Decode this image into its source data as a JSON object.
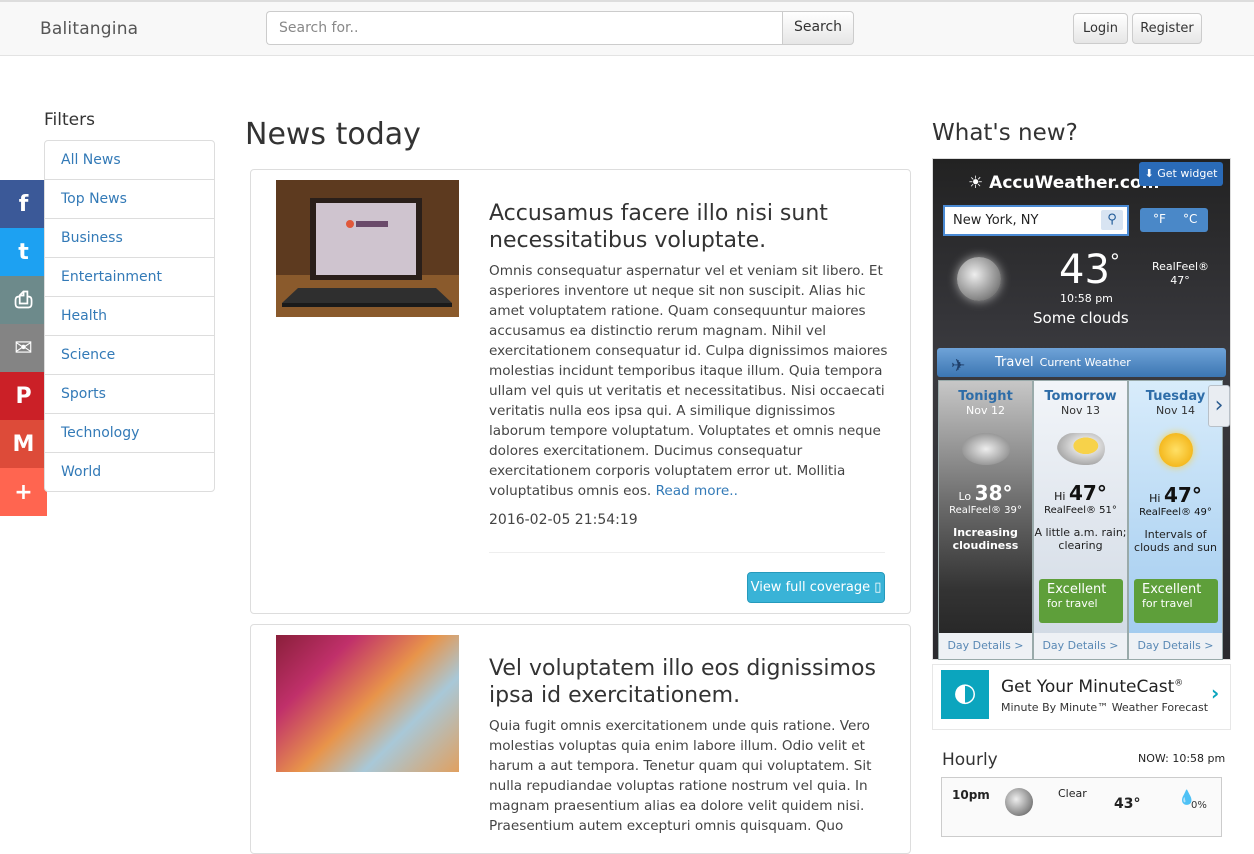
{
  "navbar": {
    "brand": "Balitangina",
    "search_placeholder": "Search for..",
    "search_label": "Search",
    "login_label": "Login",
    "register_label": "Register"
  },
  "social": [
    {
      "name": "facebook",
      "glyph": "f",
      "color": "#3b5998"
    },
    {
      "name": "twitter",
      "glyph": "t",
      "color": "#1da1f2"
    },
    {
      "name": "print",
      "glyph": "⎙",
      "color": "#6d8a8b"
    },
    {
      "name": "email",
      "glyph": "✉",
      "color": "#848484"
    },
    {
      "name": "pinterest",
      "glyph": "P",
      "color": "#cb2027"
    },
    {
      "name": "gmail",
      "glyph": "M",
      "color": "#dd4b39"
    },
    {
      "name": "more",
      "glyph": "+",
      "color": "#ff6550"
    }
  ],
  "filters": {
    "title": "Filters",
    "items": [
      "All News",
      "Top News",
      "Business",
      "Entertainment",
      "Health",
      "Science",
      "Sports",
      "Technology",
      "World"
    ]
  },
  "news": {
    "heading": "News today",
    "articles": [
      {
        "title": "Accusamus facere illo nisi sunt necessitatibus voluptate.",
        "body": "Omnis consequatur aspernatur vel et veniam sit libero. Et asperiores inventore ut neque sit non suscipit. Alias hic amet voluptatem ratione. Quam consequuntur maiores accusamus ea distinctio rerum magnam. Nihil vel exercitationem consequatur id. Culpa dignissimos maiores molestias incidunt temporibus itaque illum. Quia tempora ullam vel quis ut veritatis et necessitatibus. Nisi occaecati veritatis nulla eos ipsa qui. A similique dignissimos laborum tempore voluptatum. Voluptates et omnis neque dolores exercitationem. Ducimus consequatur exercitationem corporis voluptatem error ut. Mollitia voluptatibus omnis eos.",
        "read_more": "Read more..",
        "date": "2016-02-05 21:54:19",
        "coverage_label": "View full coverage ▯"
      },
      {
        "title": "Vel voluptatem illo eos dignissimos ipsa id exercitationem.",
        "body": "Quia fugit omnis exercitationem unde quis ratione. Vero molestias voluptas quia enim labore illum. Odio velit et harum a aut tempora. Tenetur quam qui voluptatem. Sit nulla repudiandae voluptas ratione nostrum vel quia. In magnam praesentium alias ea dolore velit quidem nisi. Praesentium autem excepturi omnis quisquam. Quo"
      }
    ]
  },
  "sidebar": {
    "title": "What's new?"
  },
  "accuweather": {
    "logo": "AccuWeather.com",
    "get_widget": "Get widget",
    "location": "New York, NY",
    "unit_f": "°F",
    "unit_c": "°C",
    "temp": "43",
    "degree": "°",
    "time": "10:58 pm",
    "condition": "Some clouds",
    "realfeel_label": "RealFeel®",
    "realfeel_value": "47°",
    "travel_label": "Travel",
    "travel_sub": "Current Weather",
    "days": [
      {
        "name": "Tonight",
        "date": "Nov 12",
        "temp_prefix": "Lo",
        "temp": "38°",
        "realfeel": "RealFeel® 39°",
        "desc": "Increasing cloudiness",
        "details": "Day Details >"
      },
      {
        "name": "Tomorrow",
        "date": "Nov 13",
        "temp_prefix": "Hi",
        "temp": "47°",
        "realfeel": "RealFeel® 51°",
        "desc": "A little a.m. rain; clearing",
        "travel": "Excellent",
        "travel_sub": "for travel",
        "details": "Day Details >"
      },
      {
        "name": "Tuesday",
        "date": "Nov 14",
        "temp_prefix": "Hi",
        "temp": "47°",
        "realfeel": "RealFeel® 49°",
        "desc": "Intervals of clouds and sun",
        "travel": "Excellent",
        "travel_sub": "for travel",
        "details": "Day Details >"
      }
    ]
  },
  "minutecast": {
    "title": "Get Your MinuteCast",
    "reg": "®",
    "subtitle": "Minute By Minute™ Weather Forecast"
  },
  "hourly": {
    "title": "Hourly",
    "now": "NOW: 10:58 pm",
    "row": {
      "time": "10pm",
      "condition": "Clear",
      "temp": "43°",
      "precip": "0%"
    }
  }
}
